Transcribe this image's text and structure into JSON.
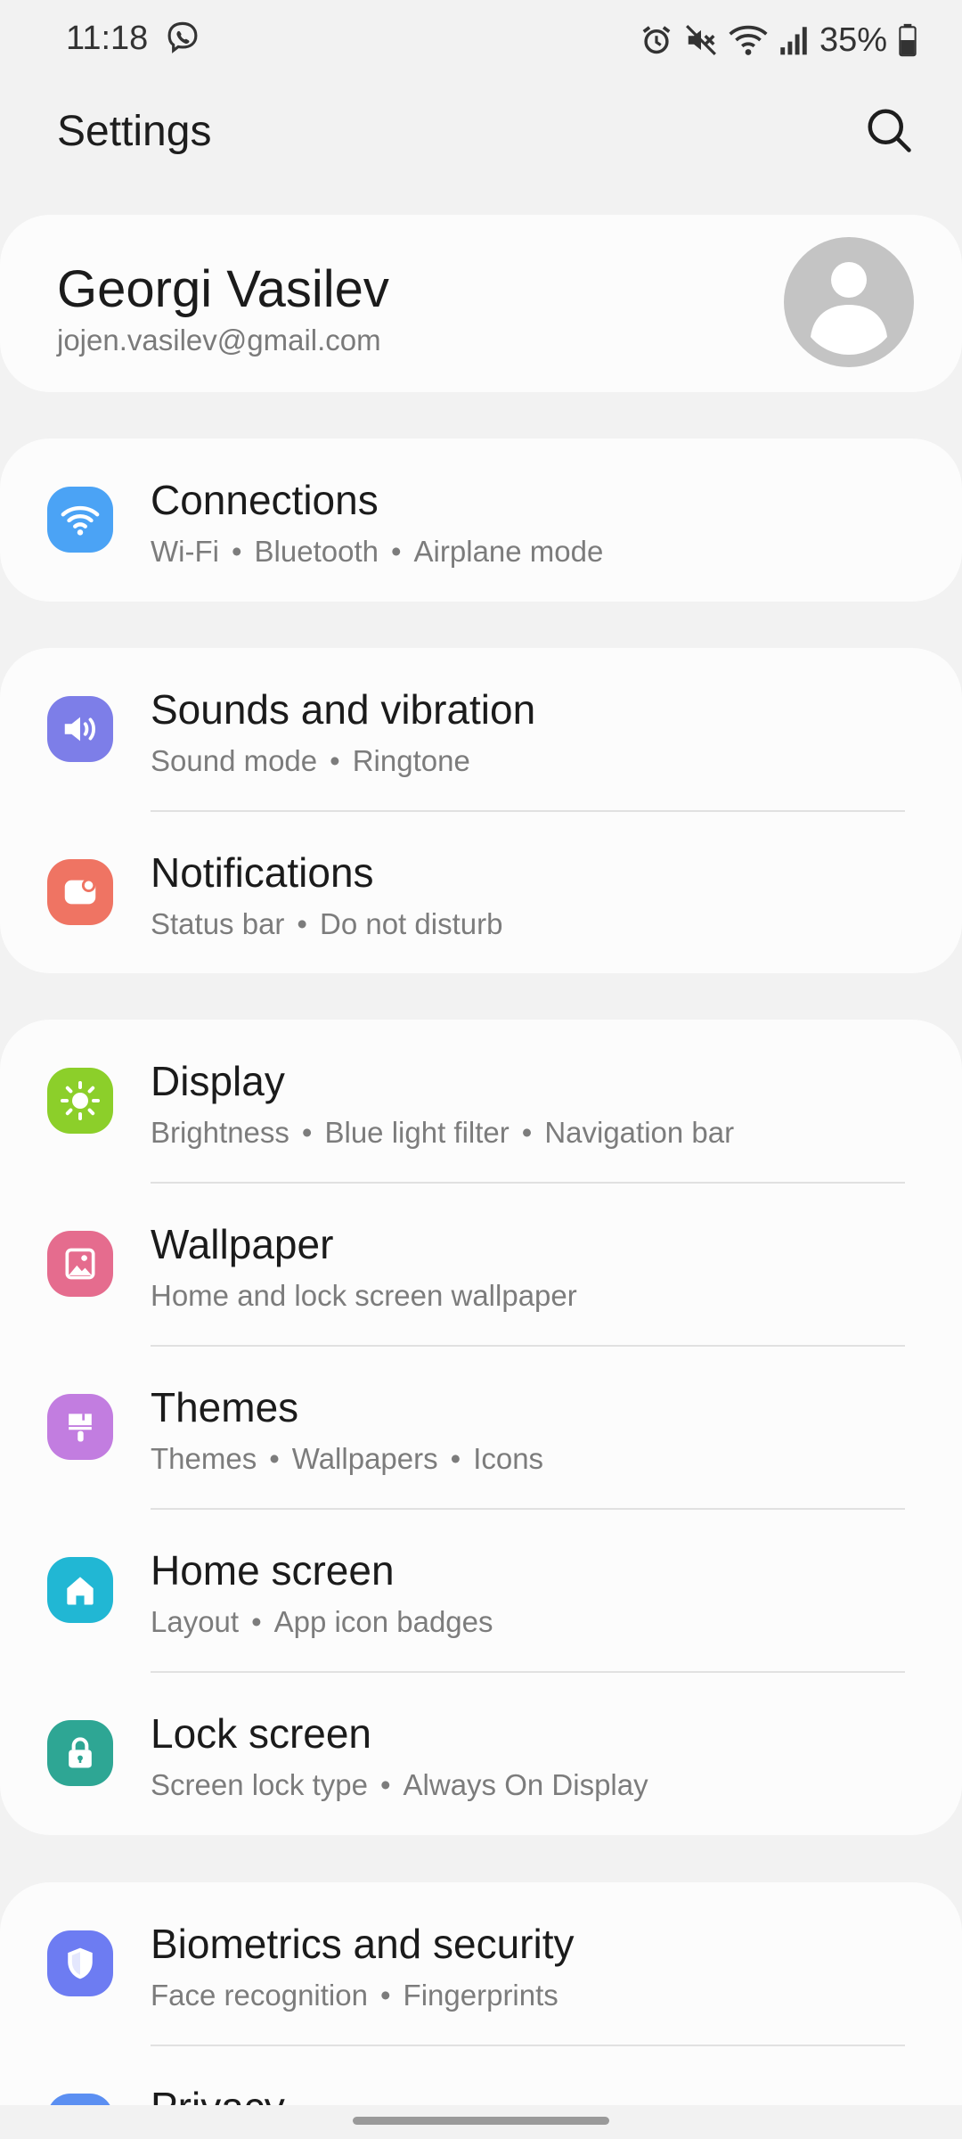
{
  "status_bar": {
    "time": "11:18",
    "battery_text": "35%",
    "icons": [
      "viber-icon",
      "alarm-icon",
      "mute-icon",
      "wifi-icon",
      "signal-icon",
      "battery-icon"
    ]
  },
  "header": {
    "title": "Settings",
    "search_icon": "search-icon"
  },
  "profile": {
    "name": "Georgi Vasilev",
    "email": "jojen.vasilev@gmail.com"
  },
  "groups": [
    {
      "items": [
        {
          "title": "Connections",
          "subs": [
            "Wi-Fi",
            "Bluetooth",
            "Airplane mode"
          ],
          "icon": "wifi-icon",
          "color": "#4ba3f5"
        }
      ]
    },
    {
      "items": [
        {
          "title": "Sounds and vibration",
          "subs": [
            "Sound mode",
            "Ringtone"
          ],
          "icon": "volume-icon",
          "color": "#7d7ee8"
        },
        {
          "title": "Notifications",
          "subs": [
            "Status bar",
            "Do not disturb"
          ],
          "icon": "notification-icon",
          "color": "#ef7463"
        }
      ]
    },
    {
      "items": [
        {
          "title": "Display",
          "subs": [
            "Brightness",
            "Blue light filter",
            "Navigation bar"
          ],
          "icon": "sun-icon",
          "color": "#8ccf2a"
        },
        {
          "title": "Wallpaper",
          "subs": [
            "Home and lock screen wallpaper"
          ],
          "icon": "image-icon",
          "color": "#e56c8e"
        },
        {
          "title": "Themes",
          "subs": [
            "Themes",
            "Wallpapers",
            "Icons"
          ],
          "icon": "brush-icon",
          "color": "#c27de0"
        },
        {
          "title": "Home screen",
          "subs": [
            "Layout",
            "App icon badges"
          ],
          "icon": "home-icon",
          "color": "#21b7d4"
        },
        {
          "title": "Lock screen",
          "subs": [
            "Screen lock type",
            "Always On Display"
          ],
          "icon": "lock-icon",
          "color": "#2ea694"
        }
      ]
    },
    {
      "items": [
        {
          "title": "Biometrics and security",
          "subs": [
            "Face recognition",
            "Fingerprints"
          ],
          "icon": "shield-icon",
          "color": "#6d7cf2"
        },
        {
          "title": "Privacy",
          "subs": [],
          "icon": "privacy-icon",
          "color": "#5b8ff2"
        }
      ]
    }
  ],
  "colors": {
    "background": "#f2f2f2",
    "card": "#fcfcfc",
    "primary_text": "#1b1b1b",
    "secondary_text": "#7c7c7c"
  }
}
